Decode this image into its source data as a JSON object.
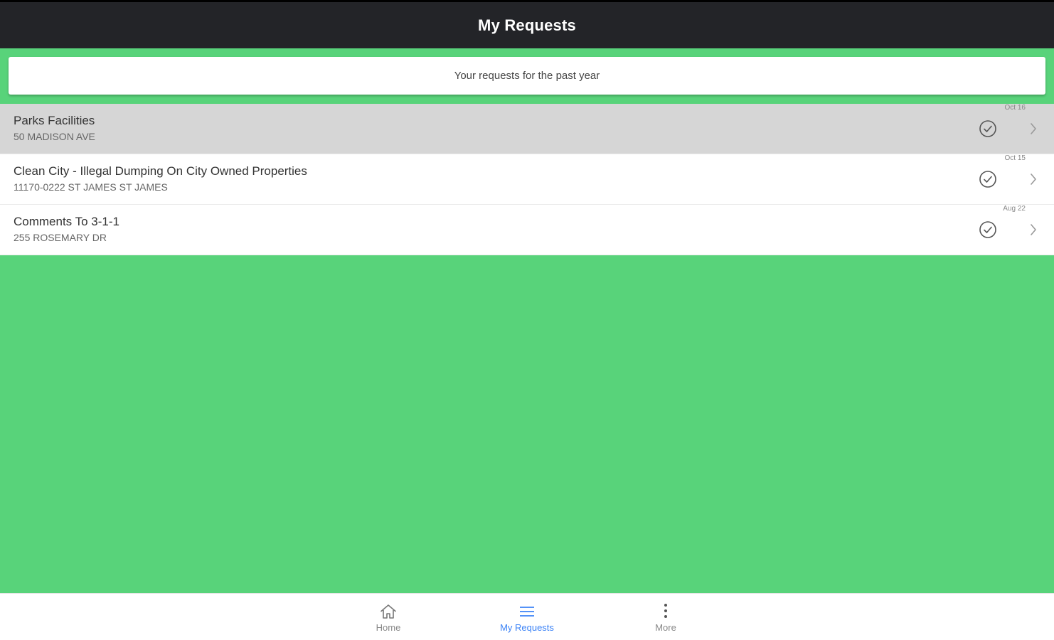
{
  "header": {
    "title": "My Requests"
  },
  "banner": {
    "text": "Your requests for the past year"
  },
  "requests": [
    {
      "title": "Parks Facilities",
      "address": "50 MADISON AVE",
      "date": "Oct 16",
      "status": "closed"
    },
    {
      "title": "Clean City - Illegal Dumping On City Owned Properties",
      "address": "11170-0222 ST JAMES ST JAMES",
      "date": "Oct 15",
      "status": "closed"
    },
    {
      "title": "Comments To 3-1-1",
      "address": "255 ROSEMARY DR",
      "date": "Aug 22",
      "status": "closed"
    }
  ],
  "nav": {
    "home": "Home",
    "my_requests": "My Requests",
    "more": "More",
    "active": "my_requests"
  },
  "colors": {
    "header_bg": "#232428",
    "background": "#58d37a",
    "selected_row": "#d6d6d6",
    "active_nav": "#3b82f6"
  },
  "icons": {
    "status": "check-circle-icon",
    "chevron": "chevron-right-icon",
    "home": "home-icon",
    "my_requests": "list-icon",
    "more": "more-vertical-icon"
  }
}
